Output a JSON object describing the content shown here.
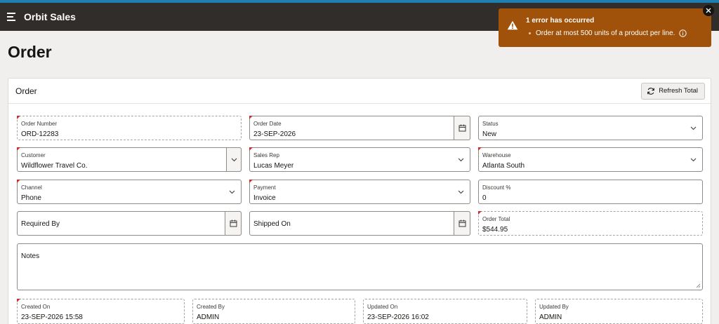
{
  "app": {
    "title": "Orbit Sales"
  },
  "page": {
    "title": "Order"
  },
  "region": {
    "title": "Order",
    "refresh_label": "Refresh Total"
  },
  "fields": {
    "order_number": {
      "label": "Order Number",
      "value": "ORD-12283"
    },
    "order_date": {
      "label": "Order Date",
      "value": "23-SEP-2026"
    },
    "status": {
      "label": "Status",
      "value": "New"
    },
    "customer": {
      "label": "Customer",
      "value": "Wildflower Travel Co."
    },
    "sales_rep": {
      "label": "Sales Rep",
      "value": "Lucas Meyer"
    },
    "warehouse": {
      "label": "Warehouse",
      "value": "Atlanta South"
    },
    "channel": {
      "label": "Channel",
      "value": "Phone"
    },
    "payment": {
      "label": "Payment",
      "value": "Invoice"
    },
    "discount": {
      "label": "Discount %",
      "value": "0"
    },
    "required_by": {
      "label": "Required By",
      "value": ""
    },
    "shipped_on": {
      "label": "Shipped On",
      "value": ""
    },
    "order_total": {
      "label": "Order Total",
      "value": "$544.95"
    },
    "notes": {
      "label": "Notes",
      "value": ""
    },
    "created_on": {
      "label": "Created On",
      "value": "23-SEP-2026 15:58"
    },
    "created_by": {
      "label": "Created By",
      "value": "ADMIN"
    },
    "updated_on": {
      "label": "Updated On",
      "value": "23-SEP-2026 16:02"
    },
    "updated_by": {
      "label": "Updated By",
      "value": "ADMIN"
    }
  },
  "error_toast": {
    "title": "1 error has occurred",
    "message": "Order at most 500 units of a product per line."
  },
  "colors": {
    "topbar": "#312d2a",
    "accent_stripe": "#1e7fb0",
    "error_toast": "#a0520a",
    "required_marker": "#c7322e"
  },
  "icons": [
    "menu-icon",
    "refresh-icon",
    "calendar-icon",
    "chevron-down-icon",
    "warning-icon",
    "info-icon",
    "close-icon"
  ]
}
